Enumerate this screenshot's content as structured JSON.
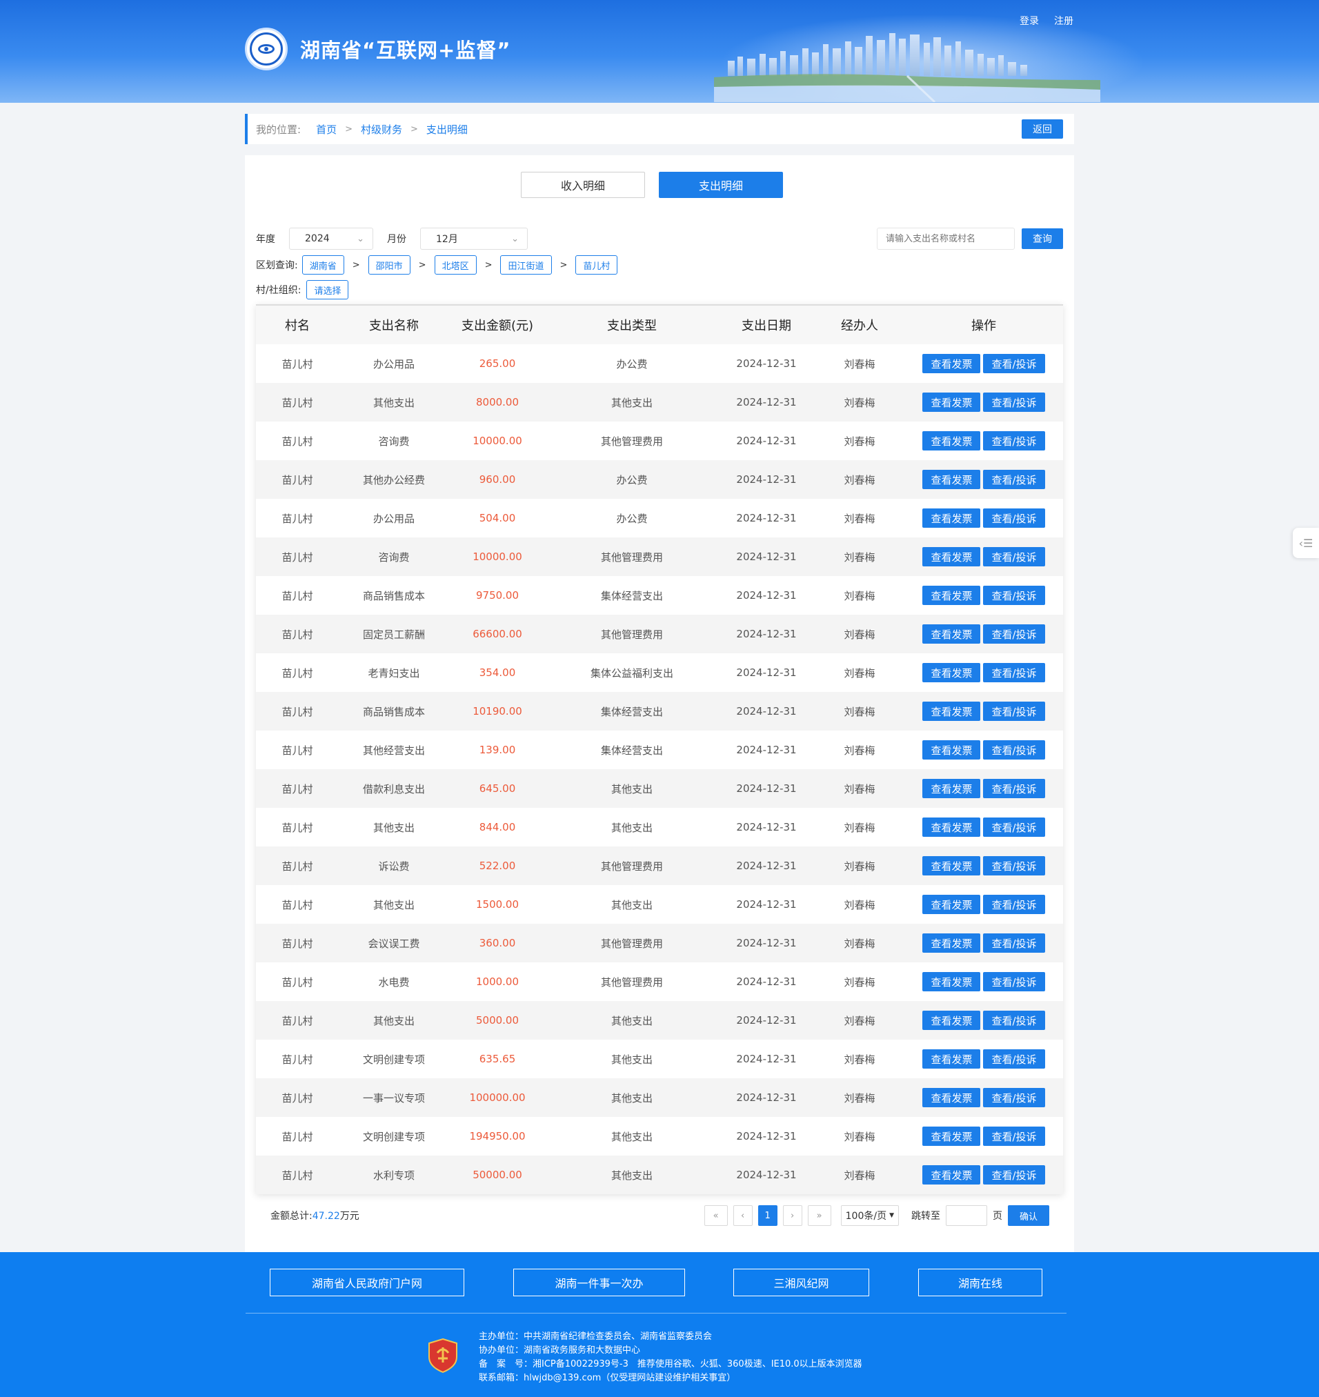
{
  "header": {
    "site_title": "湖南省“互联网+监督”",
    "login": "登录",
    "register": "注册"
  },
  "breadcrumb": {
    "label": "我的位置:",
    "items": [
      "首页",
      "村级财务",
      "支出明细"
    ],
    "back": "返回"
  },
  "tabs": [
    {
      "label": "收入明细",
      "active": false
    },
    {
      "label": "支出明细",
      "active": true
    }
  ],
  "filters": {
    "year_label": "年度",
    "year_value": "2024",
    "month_label": "月份",
    "month_value": "12月",
    "search_placeholder": "请输入支出名称或村名",
    "search_button": "查询",
    "region_label": "区划查询:",
    "regions": [
      "湖南省",
      "邵阳市",
      "北塔区",
      "田江街道",
      "苗儿村"
    ],
    "org_label": "村/社组织:",
    "org_value": "请选择"
  },
  "table": {
    "headers": [
      "村名",
      "支出名称",
      "支出金额(元)",
      "支出类型",
      "支出日期",
      "经办人",
      "操作"
    ],
    "btn_invoice": "查看发票",
    "btn_complain": "查看/投诉",
    "rows": [
      [
        "苗儿村",
        "办公用品",
        "265.00",
        "办公费",
        "2024-12-31",
        "刘春梅"
      ],
      [
        "苗儿村",
        "其他支出",
        "8000.00",
        "其他支出",
        "2024-12-31",
        "刘春梅"
      ],
      [
        "苗儿村",
        "咨询费",
        "10000.00",
        "其他管理费用",
        "2024-12-31",
        "刘春梅"
      ],
      [
        "苗儿村",
        "其他办公经费",
        "960.00",
        "办公费",
        "2024-12-31",
        "刘春梅"
      ],
      [
        "苗儿村",
        "办公用品",
        "504.00",
        "办公费",
        "2024-12-31",
        "刘春梅"
      ],
      [
        "苗儿村",
        "咨询费",
        "10000.00",
        "其他管理费用",
        "2024-12-31",
        "刘春梅"
      ],
      [
        "苗儿村",
        "商品销售成本",
        "9750.00",
        "集体经营支出",
        "2024-12-31",
        "刘春梅"
      ],
      [
        "苗儿村",
        "固定员工薪酬",
        "66600.00",
        "其他管理费用",
        "2024-12-31",
        "刘春梅"
      ],
      [
        "苗儿村",
        "老青妇支出",
        "354.00",
        "集体公益福利支出",
        "2024-12-31",
        "刘春梅"
      ],
      [
        "苗儿村",
        "商品销售成本",
        "10190.00",
        "集体经营支出",
        "2024-12-31",
        "刘春梅"
      ],
      [
        "苗儿村",
        "其他经营支出",
        "139.00",
        "集体经营支出",
        "2024-12-31",
        "刘春梅"
      ],
      [
        "苗儿村",
        "借款利息支出",
        "645.00",
        "其他支出",
        "2024-12-31",
        "刘春梅"
      ],
      [
        "苗儿村",
        "其他支出",
        "844.00",
        "其他支出",
        "2024-12-31",
        "刘春梅"
      ],
      [
        "苗儿村",
        "诉讼费",
        "522.00",
        "其他管理费用",
        "2024-12-31",
        "刘春梅"
      ],
      [
        "苗儿村",
        "其他支出",
        "1500.00",
        "其他支出",
        "2024-12-31",
        "刘春梅"
      ],
      [
        "苗儿村",
        "会议误工费",
        "360.00",
        "其他管理费用",
        "2024-12-31",
        "刘春梅"
      ],
      [
        "苗儿村",
        "水电费",
        "1000.00",
        "其他管理费用",
        "2024-12-31",
        "刘春梅"
      ],
      [
        "苗儿村",
        "其他支出",
        "5000.00",
        "其他支出",
        "2024-12-31",
        "刘春梅"
      ],
      [
        "苗儿村",
        "文明创建专项",
        "635.65",
        "其他支出",
        "2024-12-31",
        "刘春梅"
      ],
      [
        "苗儿村",
        "一事一议专项",
        "100000.00",
        "其他支出",
        "2024-12-31",
        "刘春梅"
      ],
      [
        "苗儿村",
        "文明创建专项",
        "194950.00",
        "其他支出",
        "2024-12-31",
        "刘春梅"
      ],
      [
        "苗儿村",
        "水利专项",
        "50000.00",
        "其他支出",
        "2024-12-31",
        "刘春梅"
      ]
    ]
  },
  "summary": {
    "label": "金额总计:",
    "value": "47.22",
    "unit": "万元"
  },
  "pagination": {
    "first": "«",
    "prev": "‹",
    "current": "1",
    "next": "›",
    "last": "»",
    "per_page": "100条/页",
    "jump_label": "跳转至",
    "page_unit": "页",
    "confirm": "确认"
  },
  "footer": {
    "links": [
      "湖南省人民政府门户网",
      "湖南一件事一次办",
      "三湘风纪网",
      "湖南在线"
    ],
    "info": [
      "主办单位：中共湖南省纪律检查委员会、湖南省监察委员会",
      "协办单位：湖南省政务服务和大数据中心",
      "备　案　号：湘ICP备10022939号-3　推荐使用谷歌、火狐、360极速、IE10.0以上版本浏览器",
      "联系邮箱：hlwjdb@139.com（仅受理网站建设维护相关事宜）"
    ]
  },
  "colors": {
    "primary": "#1c7ee9",
    "amount": "#ec5a3a",
    "footer_bg": "#0e7ef0"
  }
}
